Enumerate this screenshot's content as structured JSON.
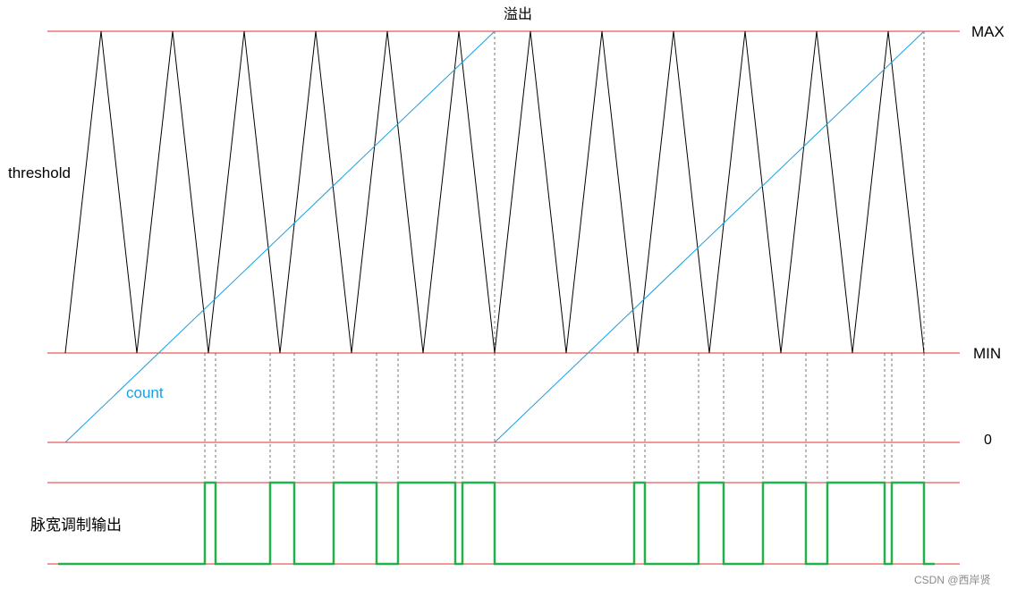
{
  "labels": {
    "overflow": "溢出",
    "max": "MAX",
    "min": "MIN",
    "zero": "0",
    "threshold": "threshold",
    "count": "count",
    "pwm": "脉宽调制输出",
    "watermark": "CSDN @西岸贤"
  },
  "colors": {
    "reference_line": "#e03030",
    "threshold_wave": "#000000",
    "count_ramp": "#1aa0e0",
    "pwm_output": "#22b14c",
    "dashed_guide": "#555555"
  }
}
